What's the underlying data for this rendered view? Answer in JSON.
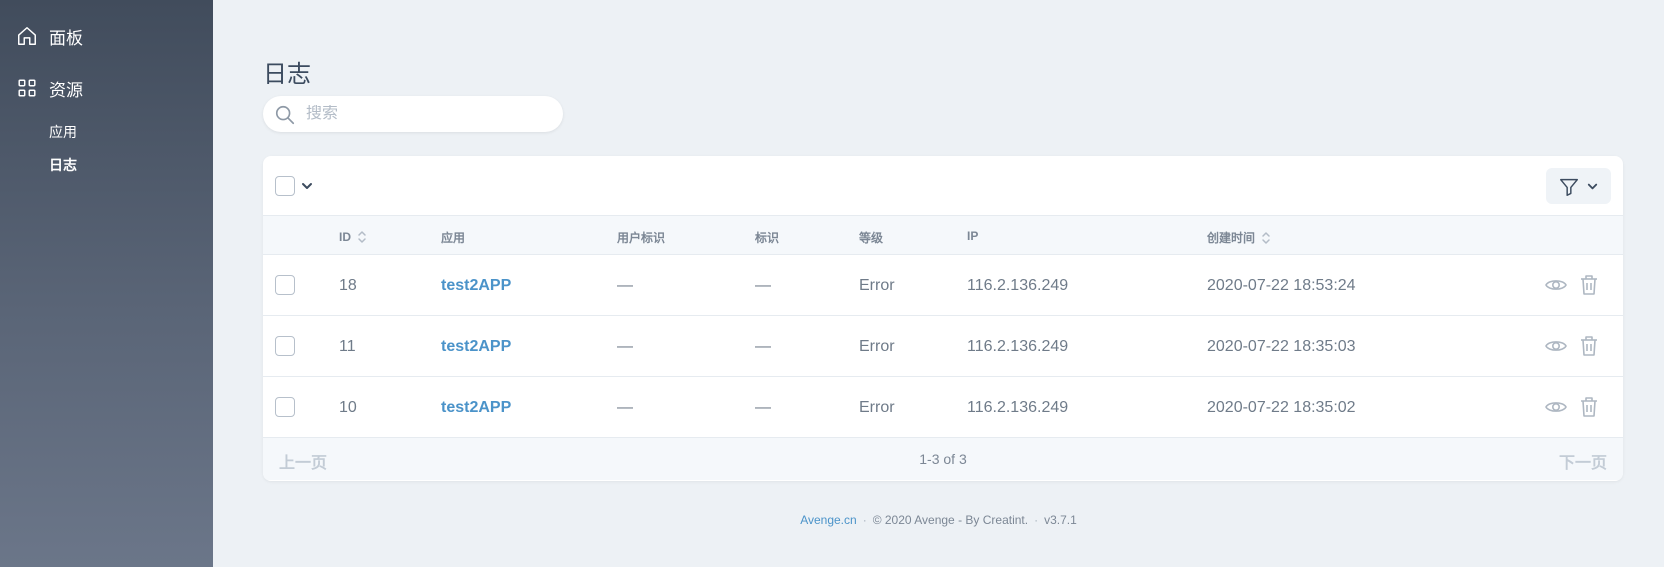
{
  "sidebar": {
    "sections": [
      {
        "label": "面板",
        "icon": "home-icon"
      },
      {
        "label": "资源",
        "icon": "grid-icon"
      }
    ],
    "resources": [
      {
        "label": "应用"
      },
      {
        "label": "日志",
        "active": true
      }
    ]
  },
  "page": {
    "title": "日志",
    "search_placeholder": "搜索"
  },
  "table": {
    "columns": {
      "id": "ID",
      "app": "应用",
      "user_id": "用户标识",
      "tag": "标识",
      "level": "等级",
      "ip": "IP",
      "created_at": "创建时间"
    },
    "rows": [
      {
        "id": "18",
        "app": "test2APP",
        "user_id": "—",
        "tag": "—",
        "level": "Error",
        "ip": "116.2.136.249",
        "created_at": "2020-07-22 18:53:24"
      },
      {
        "id": "11",
        "app": "test2APP",
        "user_id": "—",
        "tag": "—",
        "level": "Error",
        "ip": "116.2.136.249",
        "created_at": "2020-07-22 18:35:03"
      },
      {
        "id": "10",
        "app": "test2APP",
        "user_id": "—",
        "tag": "—",
        "level": "Error",
        "ip": "116.2.136.249",
        "created_at": "2020-07-22 18:35:02"
      }
    ],
    "pagination": {
      "prev": "上一页",
      "info": "1-3 of 3",
      "next": "下一页"
    }
  },
  "footer": {
    "link": "Avenge.cn",
    "copyright": "© 2020 Avenge - By Creatint.",
    "version": "v3.7.1"
  },
  "colors": {
    "sidebar_top": "#414c5c",
    "sidebar_bottom": "#6b7689",
    "background": "#edf1f5",
    "link": "#4b93c9",
    "text": "#3c4b5f"
  }
}
